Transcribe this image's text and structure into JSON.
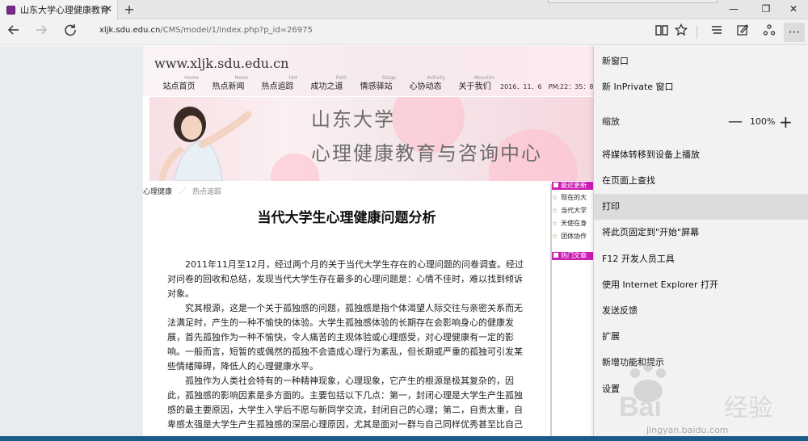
{
  "browser": {
    "tab_title": "山东大学心理健康教育与",
    "tab_close": "✕",
    "new_tab": "+",
    "url_host": "xljk.sdu.edu.cn",
    "url_path": "/CMS/model/1/index.php?p_id=26975",
    "window_controls": {
      "minimize": "—",
      "maximize": "❐",
      "close": "✕"
    }
  },
  "site": {
    "url_text": "www.xljk.sdu.edu.cn",
    "nav": [
      {
        "en": "Home",
        "cn": "站点首页"
      },
      {
        "en": "News",
        "cn": "热点新闻"
      },
      {
        "en": "Hot",
        "cn": "热点追踪"
      },
      {
        "en": "Path",
        "cn": "成功之道"
      },
      {
        "en": "Stage",
        "cn": "情感驿站"
      },
      {
        "en": "Activity",
        "cn": "心协动态"
      },
      {
        "en": "AboutUs",
        "cn": "关于我们"
      }
    ],
    "date_text": "2016．11．6　PM:22：35：8",
    "banner_line1": "山东大学",
    "banner_line2": "心理健康教育与咨询中心"
  },
  "breadcrumb": {
    "root": "心理健康",
    "sep": "／",
    "current": "热点追踪"
  },
  "article": {
    "title": "当代大学生心理健康问题分析",
    "p1": "2011年11月至12月，经过两个月的关于当代大学生存在的心理问题的问卷调查。经过对问卷的回收和总结，发现当代大学生存在最多的心理问题是：心情不佳时，难以找到倾诉对象。",
    "p2": "究其根源，这是一个关于孤独感的问题，孤独感是指个体渴望人际交往与亲密关系而无法满足时，产生的一种不愉快的体验。大学生孤独感体验的长期存在会影响身心的健康发展，首先孤独作为一种不愉快，令人痛苦的主观体验或心理感受，对心理健康有一定的影响。一般而言，短暂的或偶然的孤独不会造成心理行为紊乱，但长期或严重的孤独可引发某些情绪障碍，降低人的心理健康水平。",
    "p3": "孤独作为人类社会特有的一种精神现象，心理现象，它产生的根源是极其复杂的，因此，孤独感的影响因素是多方面的。主要包括以下几点：第一，封闭心理是大学生产生孤独感的最主要原因，大学生入学后不愿与新同学交流，封闭自己的心理；第二，自责太重，自卑感太强是大学生产生孤独感的深层心理原因，尤其是面对一群与自己同样优秀甚至比自己"
  },
  "sidebar": {
    "recent_head": "最近更新",
    "recent_items": [
      "现在的大",
      "当代大学",
      "天使在身",
      "团体协作"
    ],
    "hot_head": "热门文章"
  },
  "menu": {
    "items": [
      "新窗口",
      "新 InPrivate 窗口",
      "将媒体转移到设备上播放",
      "在页面上查找",
      "打印",
      "将此页固定到\"开始\"屏幕",
      "F12 开发人员工具",
      "使用 Internet Explorer 打开",
      "发送反馈",
      "扩展",
      "新增功能和提示",
      "设置"
    ],
    "zoom_label": "缩放",
    "zoom_value": "100%",
    "zoom_minus": "—",
    "zoom_plus": "+"
  },
  "watermark": {
    "text": "jingyan.baidu.com"
  }
}
